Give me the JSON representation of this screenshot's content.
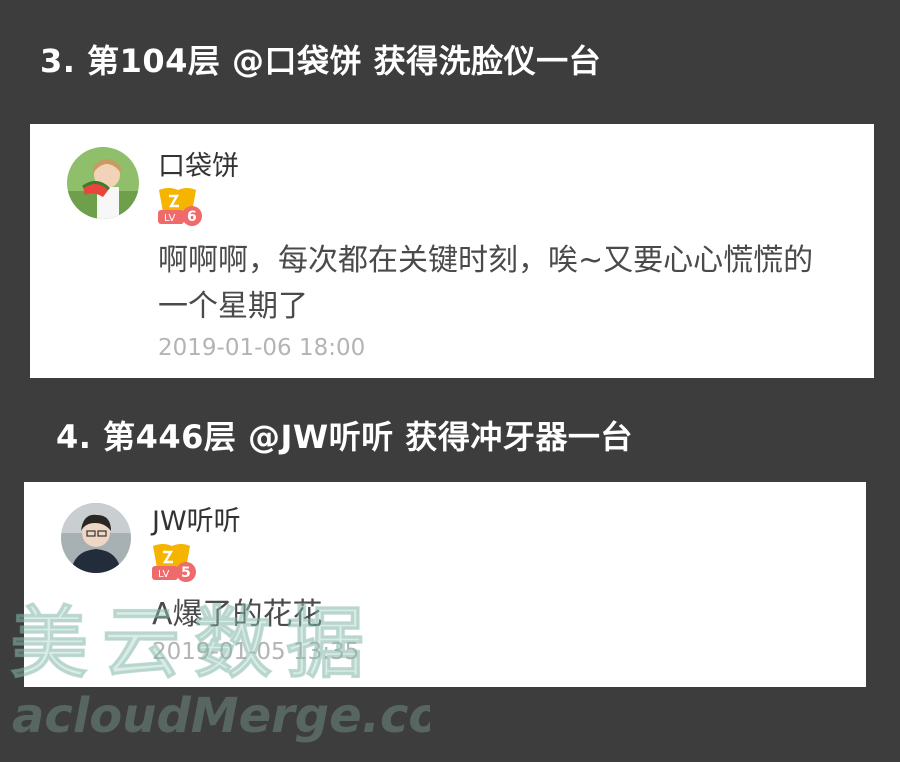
{
  "posts": [
    {
      "heading": "3. 第104层 @口袋饼  获得洗脸仪一台",
      "username": "口袋饼",
      "level": "LV",
      "level_num": "6",
      "comment": "啊啊啊，每次都在关键时刻，唉~又要心心慌慌的一个星期了",
      "time": "2019-01-06 18:00"
    },
    {
      "heading": "4. 第446层 @JW听听  获得冲牙器一台",
      "username": "JW听听",
      "level": "LV",
      "level_num": "5",
      "comment": "A爆了的花花",
      "time": "2019-01-05 13:35"
    }
  ],
  "watermark": {
    "cn": "美云数据",
    "en": "acloudMerge.com"
  },
  "colors": {
    "background": "#3e3d3d",
    "badge": "#f5b400",
    "badge_pink": "#ef6a6a",
    "timestamp": "#b4b4b4"
  }
}
